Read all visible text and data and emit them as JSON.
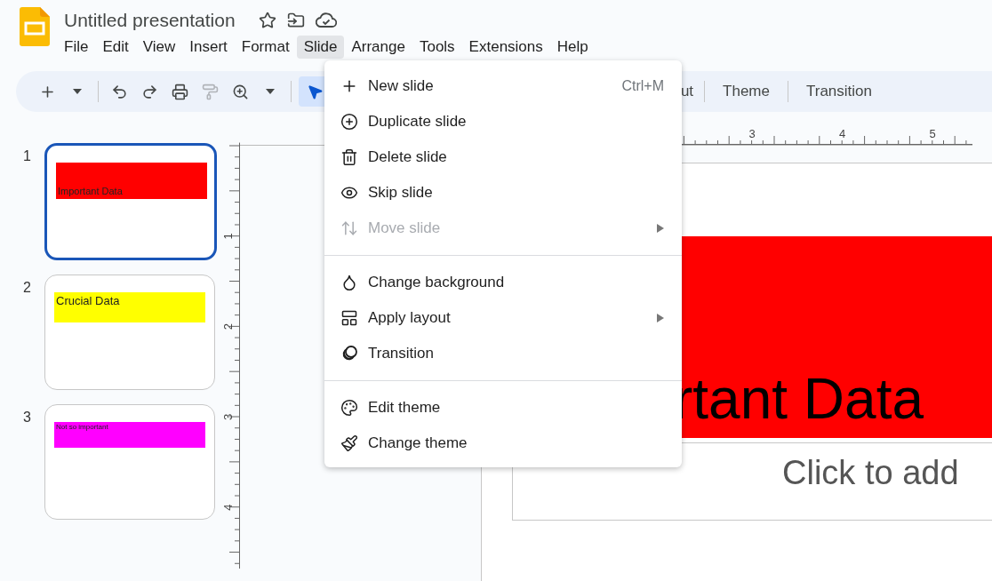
{
  "document": {
    "title": "Untitled presentation"
  },
  "menubar": [
    {
      "label": "File",
      "selected": false
    },
    {
      "label": "Edit",
      "selected": false
    },
    {
      "label": "View",
      "selected": false
    },
    {
      "label": "Insert",
      "selected": false
    },
    {
      "label": "Format",
      "selected": false
    },
    {
      "label": "Slide",
      "selected": true
    },
    {
      "label": "Arrange",
      "selected": false
    },
    {
      "label": "Tools",
      "selected": false
    },
    {
      "label": "Extensions",
      "selected": false
    },
    {
      "label": "Help",
      "selected": false
    }
  ],
  "toolbar": {
    "tools": [
      {
        "kind": "new",
        "selected": false,
        "disabled": false
      },
      {
        "kind": "caret",
        "selected": false,
        "disabled": false
      },
      {
        "kind": "undo",
        "selected": false,
        "disabled": false
      },
      {
        "kind": "redo",
        "selected": false,
        "disabled": false
      },
      {
        "kind": "print",
        "selected": false,
        "disabled": false
      },
      {
        "kind": "paint",
        "selected": false,
        "disabled": true
      },
      {
        "kind": "zoom",
        "selected": false,
        "disabled": false
      },
      {
        "kind": "caret",
        "selected": false,
        "disabled": false
      },
      {
        "kind": "select",
        "selected": true,
        "disabled": false
      }
    ],
    "buttons": [
      "ut",
      "Theme",
      "Transition"
    ]
  },
  "slides": [
    {
      "number": "1",
      "selected": true,
      "kind": "bottom",
      "text": "Important Data",
      "color": "#ff0000"
    },
    {
      "number": "2",
      "selected": false,
      "kind": "top",
      "text": "Crucial Data",
      "color": "#ffff00"
    },
    {
      "number": "3",
      "selected": false,
      "kind": "tiny",
      "text": "Not so important",
      "color": "#ff00ff"
    }
  ],
  "rulers": {
    "horizontal": [
      "3",
      "4",
      "5"
    ],
    "vertical": [
      "1",
      "2",
      "3",
      "4"
    ]
  },
  "canvas": {
    "title": "rtant Data",
    "subtitle": "Click to add"
  },
  "slide_menu": {
    "groups": [
      [
        {
          "kind": "plus",
          "label": "New slide",
          "shortcut": "Ctrl+M",
          "submenu": false,
          "disabled": false
        },
        {
          "kind": "duplicate",
          "label": "Duplicate slide",
          "submenu": false,
          "disabled": false
        },
        {
          "kind": "trash",
          "label": "Delete slide",
          "submenu": false,
          "disabled": false
        },
        {
          "kind": "eye",
          "label": "Skip slide",
          "submenu": false,
          "disabled": false
        },
        {
          "kind": "move",
          "label": "Move slide",
          "submenu": true,
          "disabled": true
        }
      ],
      [
        {
          "kind": "drop",
          "label": "Change background",
          "submenu": false,
          "disabled": false
        },
        {
          "kind": "layout",
          "label": "Apply layout",
          "submenu": true,
          "disabled": false
        },
        {
          "kind": "transition",
          "label": "Transition",
          "submenu": false,
          "disabled": false
        }
      ],
      [
        {
          "kind": "palette",
          "label": "Edit theme",
          "submenu": false,
          "disabled": false
        },
        {
          "kind": "brush",
          "label": "Change theme",
          "submenu": false,
          "disabled": false
        }
      ]
    ]
  }
}
